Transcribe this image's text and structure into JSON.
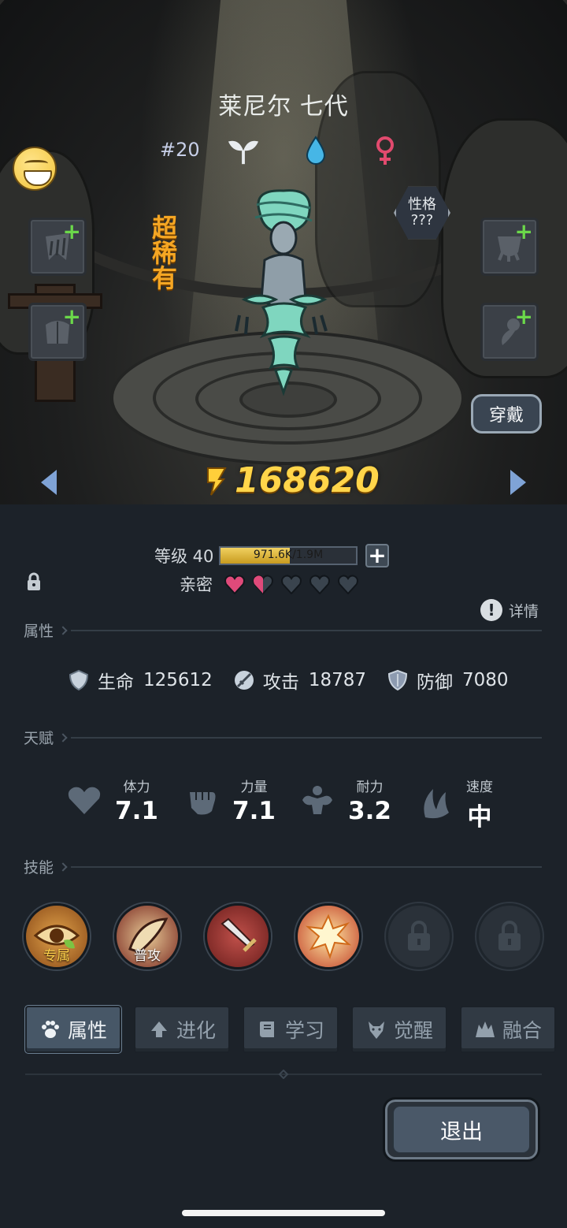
{
  "character": {
    "name": "莱尼尔 七代",
    "number": "#20",
    "rarity": "超稀有",
    "personality_label": "性格",
    "personality_value": "???",
    "power": "168620",
    "wear_button": "穿戴"
  },
  "stats": {
    "level_label": "等级 40",
    "xp_text": "971.6K/1.9M",
    "xp_fraction": 0.51,
    "intimacy_label": "亲密",
    "hearts_full": 1,
    "hearts_half": 1,
    "hearts_total": 5,
    "detail_label": "详情"
  },
  "sections": {
    "attributes": "属性",
    "talents": "天赋",
    "skills": "技能"
  },
  "attributes": [
    {
      "name": "生命",
      "value": "125612",
      "icon": "shield-heart-icon"
    },
    {
      "name": "攻击",
      "value": "18787",
      "icon": "sword-icon"
    },
    {
      "name": "防御",
      "value": "7080",
      "icon": "shield-icon"
    }
  ],
  "talents": [
    {
      "name": "体力",
      "value": "7.1",
      "icon": "heart-icon"
    },
    {
      "name": "力量",
      "value": "7.1",
      "icon": "fist-icon"
    },
    {
      "name": "耐力",
      "value": "3.2",
      "icon": "muscle-icon"
    },
    {
      "name": "速度",
      "value": "中",
      "icon": "wing-icon"
    }
  ],
  "skills": [
    {
      "label": "专属",
      "icon": "eye-leaf-icon"
    },
    {
      "label": "普攻",
      "icon": "claw-strike-icon"
    },
    {
      "label": "",
      "icon": "sword-slash-icon"
    },
    {
      "label": "",
      "icon": "explosion-icon"
    },
    {
      "label": "",
      "icon": "lock-icon"
    },
    {
      "label": "",
      "icon": "lock-icon"
    }
  ],
  "tabs": [
    {
      "label": "属性",
      "icon": "paw-icon",
      "active": true
    },
    {
      "label": "进化",
      "icon": "evolve-arrow-icon",
      "active": false
    },
    {
      "label": "学习",
      "icon": "book-icon",
      "active": false
    },
    {
      "label": "觉醒",
      "icon": "wolf-icon",
      "active": false
    },
    {
      "label": "融合",
      "icon": "fusion-icon",
      "active": false
    }
  ],
  "exit_button": "退出",
  "colors": {
    "power": "#ffd54a",
    "rarity": "#f5a623",
    "heart_full": "#e04a7a",
    "heart_empty": "#3a444e",
    "plus_green": "#6bd84a"
  }
}
